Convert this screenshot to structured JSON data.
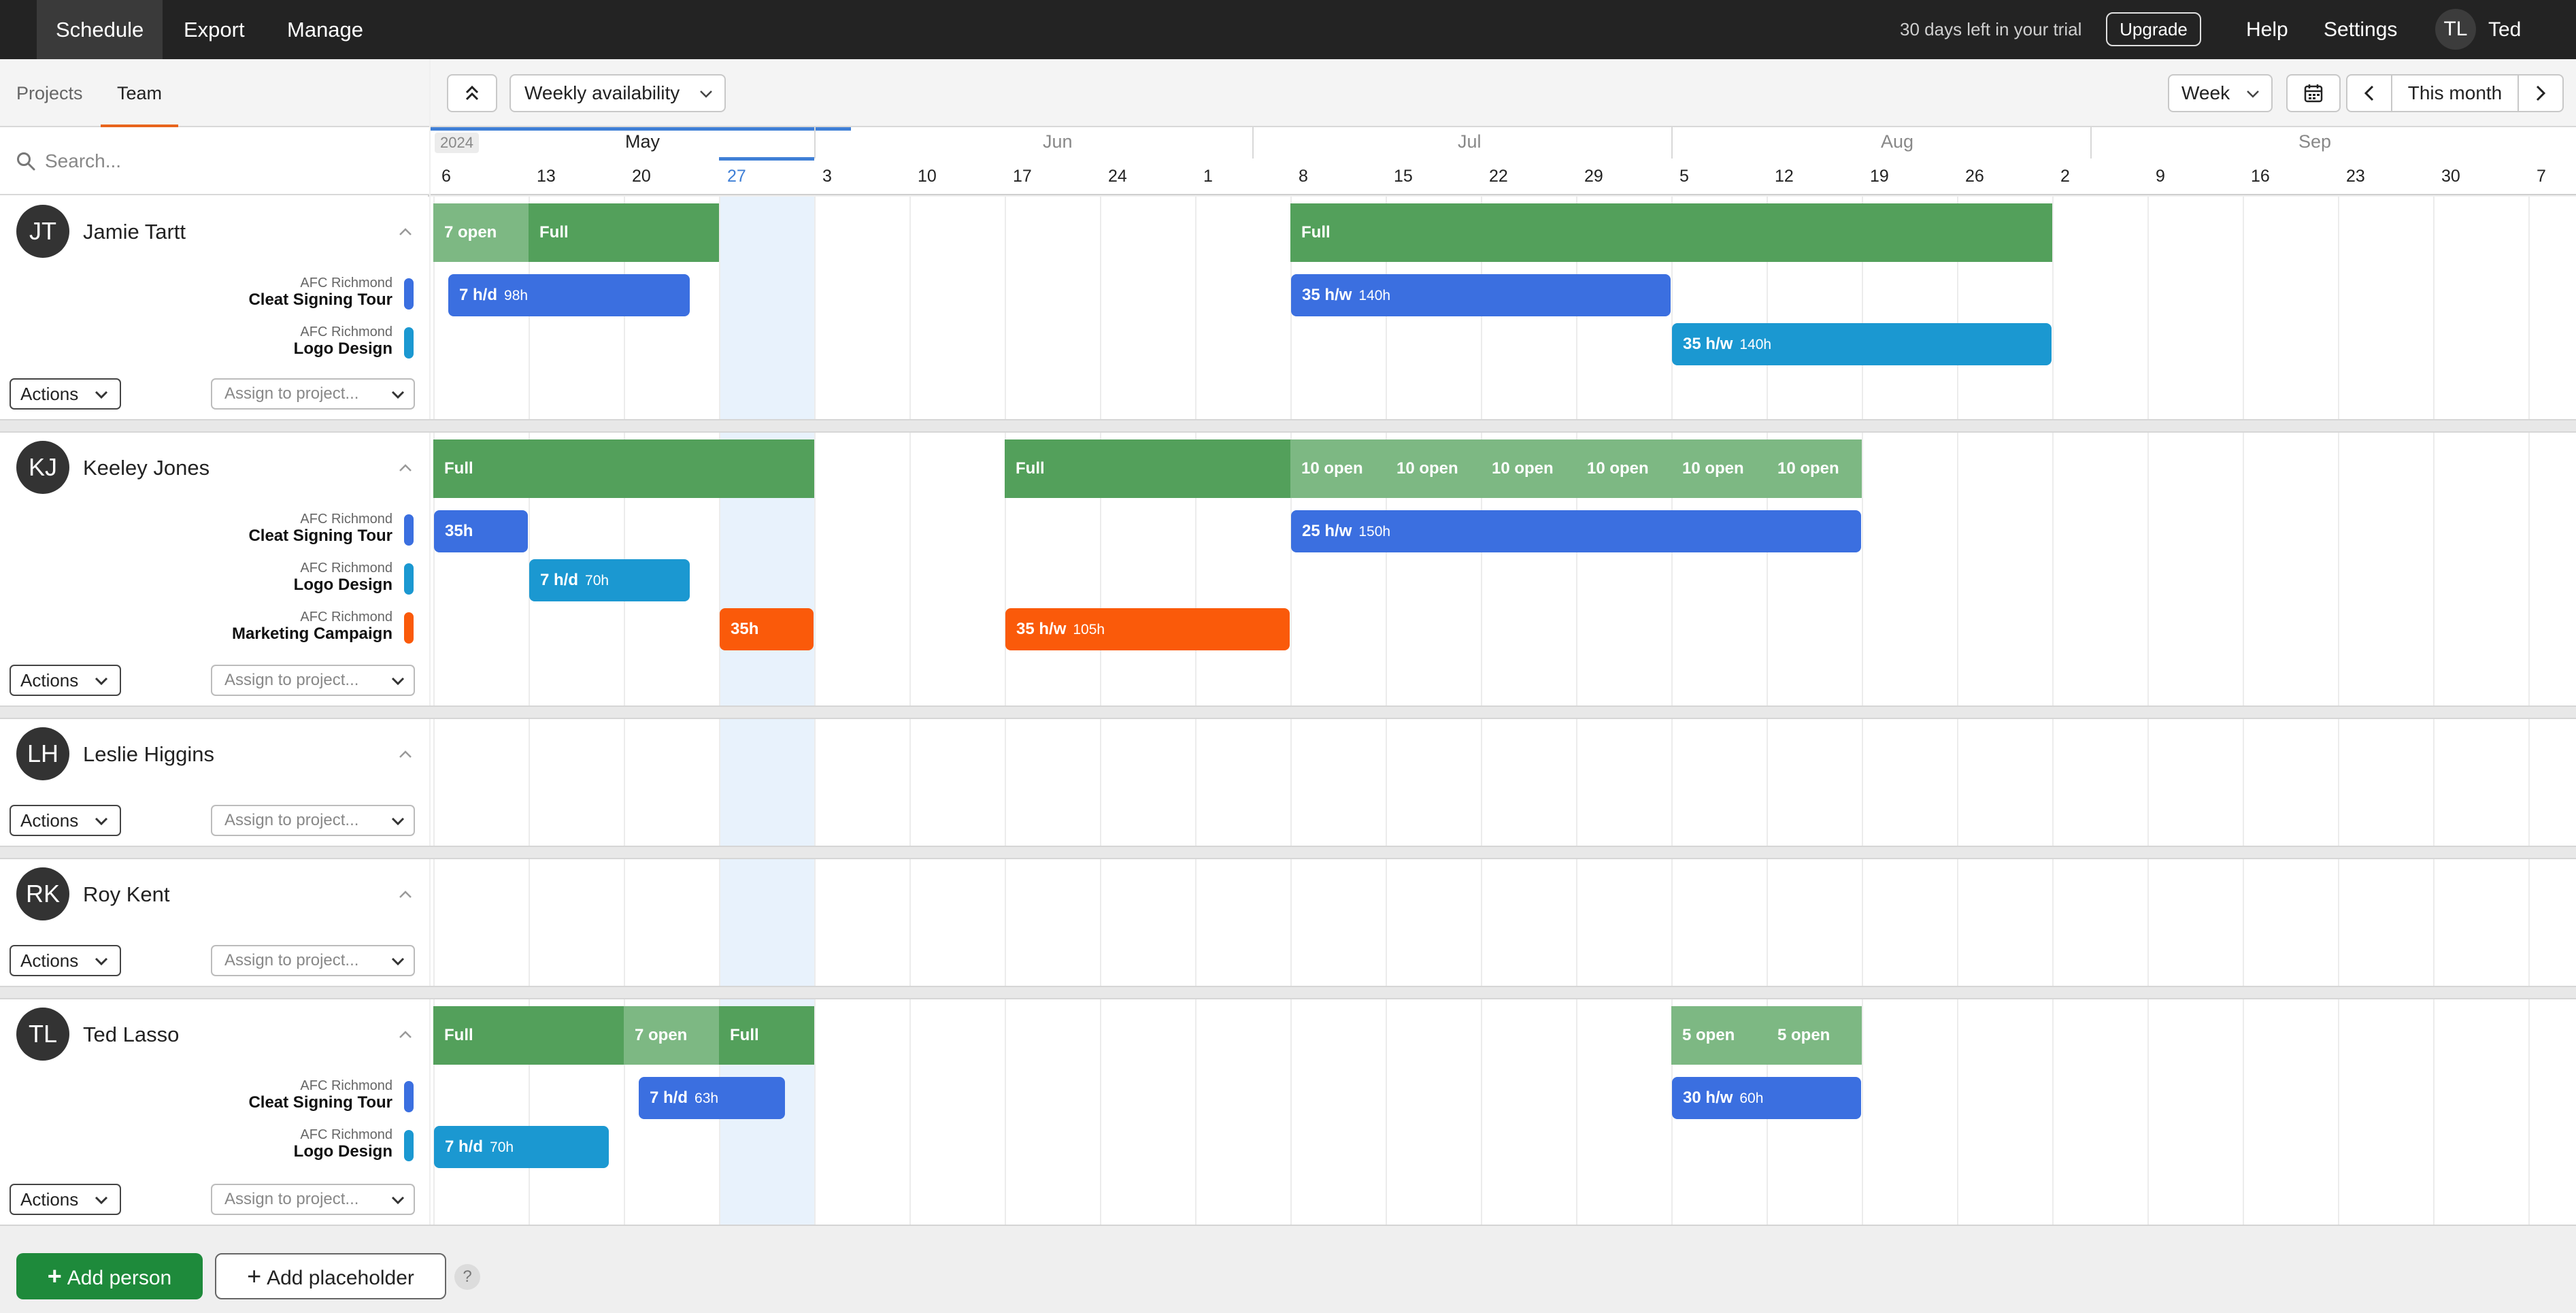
{
  "top_nav": {
    "items": [
      "Schedule",
      "Export",
      "Manage"
    ],
    "trial_text": "30 days left in your trial",
    "upgrade_label": "Upgrade",
    "help_label": "Help",
    "settings_label": "Settings",
    "user_initials": "TL",
    "user_name": "Ted"
  },
  "left_tabs": [
    "Projects",
    "Team"
  ],
  "search": {
    "placeholder": "Search..."
  },
  "toolbar": {
    "view_select": "Weekly availability",
    "scale_select": "Week",
    "range_label": "This month"
  },
  "timeline": {
    "year": "2024",
    "months": [
      "May",
      "Jun",
      "Jul",
      "Aug",
      "Sep"
    ],
    "weeks": [
      "6",
      "13",
      "20",
      "27",
      "3",
      "10",
      "17",
      "24",
      "1",
      "8",
      "15",
      "22",
      "29",
      "5",
      "12",
      "19",
      "26",
      "2",
      "9",
      "16",
      "23",
      "30",
      "7"
    ],
    "today_week_index": 3
  },
  "row_labels": {
    "actions": "Actions",
    "assign_placeholder": "Assign to project..."
  },
  "people": [
    {
      "initials": "JT",
      "name": "Jamie Tartt",
      "projects": [
        {
          "client": "AFC Richmond",
          "name": "Cleat Signing Tour",
          "color": "#3b6fe0"
        },
        {
          "client": "AFC Richmond",
          "name": "Logo Design",
          "color": "#1b98d1"
        }
      ],
      "availability": [
        {
          "start": 0,
          "span": 1,
          "label": "7 open",
          "kind": "open"
        },
        {
          "start": 1,
          "span": 2,
          "label": "Full",
          "kind": "full"
        },
        {
          "start": 9,
          "span": 8,
          "label": "Full",
          "kind": "full"
        }
      ],
      "allocations": [
        {
          "project": 0,
          "start": 0.15,
          "end": 2.7,
          "label": "7 h/d",
          "total": "98h"
        },
        {
          "project": 0,
          "start": 9,
          "end": 13,
          "label": "35 h/w",
          "total": "140h"
        },
        {
          "project": 1,
          "start": 13,
          "end": 17,
          "label": "35 h/w",
          "total": "140h"
        }
      ]
    },
    {
      "initials": "KJ",
      "name": "Keeley Jones",
      "projects": [
        {
          "client": "AFC Richmond",
          "name": "Cleat Signing Tour",
          "color": "#3b6fe0"
        },
        {
          "client": "AFC Richmond",
          "name": "Logo Design",
          "color": "#1b98d1"
        },
        {
          "client": "AFC Richmond",
          "name": "Marketing Campaign",
          "color": "#fa5a0a"
        }
      ],
      "availability": [
        {
          "start": 0,
          "span": 4,
          "label": "Full",
          "kind": "full"
        },
        {
          "start": 6,
          "span": 3,
          "label": "Full",
          "kind": "full"
        },
        {
          "start": 9,
          "span": 1,
          "label": "10 open",
          "kind": "open"
        },
        {
          "start": 10,
          "span": 1,
          "label": "10 open",
          "kind": "open"
        },
        {
          "start": 11,
          "span": 1,
          "label": "10 open",
          "kind": "open"
        },
        {
          "start": 12,
          "span": 1,
          "label": "10 open",
          "kind": "open"
        },
        {
          "start": 13,
          "span": 1,
          "label": "10 open",
          "kind": "open"
        },
        {
          "start": 14,
          "span": 1,
          "label": "10 open",
          "kind": "open"
        }
      ],
      "allocations": [
        {
          "project": 0,
          "start": 0,
          "end": 1,
          "label": "35h",
          "total": ""
        },
        {
          "project": 1,
          "start": 1,
          "end": 2.7,
          "label": "7 h/d",
          "total": "70h"
        },
        {
          "project": 2,
          "start": 3,
          "end": 4,
          "label": "35h",
          "total": ""
        },
        {
          "project": 2,
          "start": 6,
          "end": 9,
          "label": "35 h/w",
          "total": "105h"
        },
        {
          "project": 0,
          "start": 9,
          "end": 15,
          "label": "25 h/w",
          "total": "150h"
        }
      ]
    },
    {
      "initials": "LH",
      "name": "Leslie Higgins",
      "projects": [],
      "availability": [],
      "allocations": []
    },
    {
      "initials": "RK",
      "name": "Roy Kent",
      "projects": [],
      "availability": [],
      "allocations": []
    },
    {
      "initials": "TL",
      "name": "Ted Lasso",
      "projects": [
        {
          "client": "AFC Richmond",
          "name": "Cleat Signing Tour",
          "color": "#3b6fe0"
        },
        {
          "client": "AFC Richmond",
          "name": "Logo Design",
          "color": "#1b98d1"
        }
      ],
      "availability": [
        {
          "start": 0,
          "span": 2,
          "label": "Full",
          "kind": "full"
        },
        {
          "start": 2,
          "span": 1,
          "label": "7 open",
          "kind": "open"
        },
        {
          "start": 3,
          "span": 1,
          "label": "Full",
          "kind": "full"
        },
        {
          "start": 13,
          "span": 1,
          "label": "5 open",
          "kind": "open"
        },
        {
          "start": 14,
          "span": 1,
          "label": "5 open",
          "kind": "open"
        }
      ],
      "allocations": [
        {
          "project": 0,
          "start": 2.15,
          "end": 3.7,
          "label": "7 h/d",
          "total": "63h"
        },
        {
          "project": 1,
          "start": 0,
          "end": 1.85,
          "label": "7 h/d",
          "total": "70h"
        },
        {
          "project": 0,
          "start": 13,
          "end": 15,
          "label": "30 h/w",
          "total": "60h"
        }
      ]
    }
  ],
  "bottom": {
    "add_person": "Add person",
    "add_placeholder": "Add placeholder",
    "help": "?"
  }
}
